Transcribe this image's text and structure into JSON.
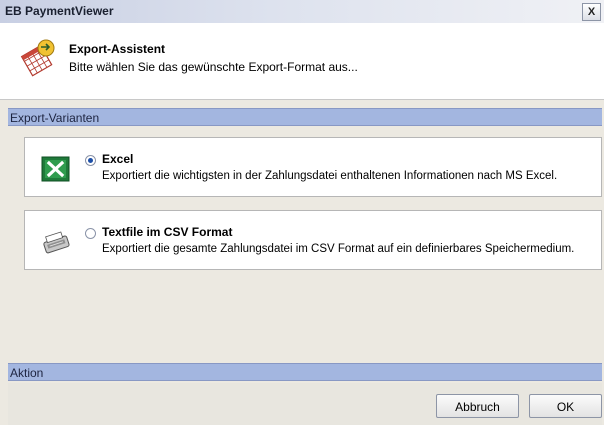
{
  "window": {
    "title": "EB PaymentViewer",
    "close_label": "X"
  },
  "header": {
    "title": "Export-Assistent",
    "subtitle": "Bitte wählen Sie das gewünschte Export-Format aus..."
  },
  "sections": {
    "variants": "Export-Varianten",
    "action": "Aktion"
  },
  "options": [
    {
      "title": "Excel",
      "description": "Exportiert die wichtigsten in der Zahlungsdatei enthaltenen Informationen nach MS Excel.",
      "selected": true,
      "icon": "excel-icon"
    },
    {
      "title": "Textfile im CSV Format",
      "description": "Exportiert die gesamte Zahlungsdatei im CSV Format auf ein definierbares Speichermedium.",
      "selected": false,
      "icon": "printer-icon"
    }
  ],
  "buttons": {
    "cancel": "Abbruch",
    "ok": "OK"
  },
  "colors": {
    "section_bar": "#a3b6e0",
    "radio_selected": "#1d4fa7",
    "excel_green": "#1f7a3a"
  }
}
